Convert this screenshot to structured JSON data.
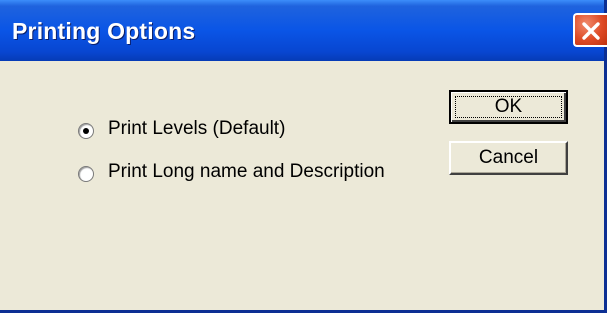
{
  "window": {
    "title": "Printing Options"
  },
  "titlebar": {
    "close_icon": "close-icon"
  },
  "options": {
    "items": [
      {
        "label": "Print Levels (Default)",
        "selected": true
      },
      {
        "label": "Print Long name and Description",
        "selected": false
      }
    ]
  },
  "buttons": {
    "ok_label": "OK",
    "cancel_label": "Cancel"
  },
  "colors": {
    "titlebar": "#0a55e6",
    "close_button": "#de4a25",
    "dialog_background": "#ece9d8"
  }
}
